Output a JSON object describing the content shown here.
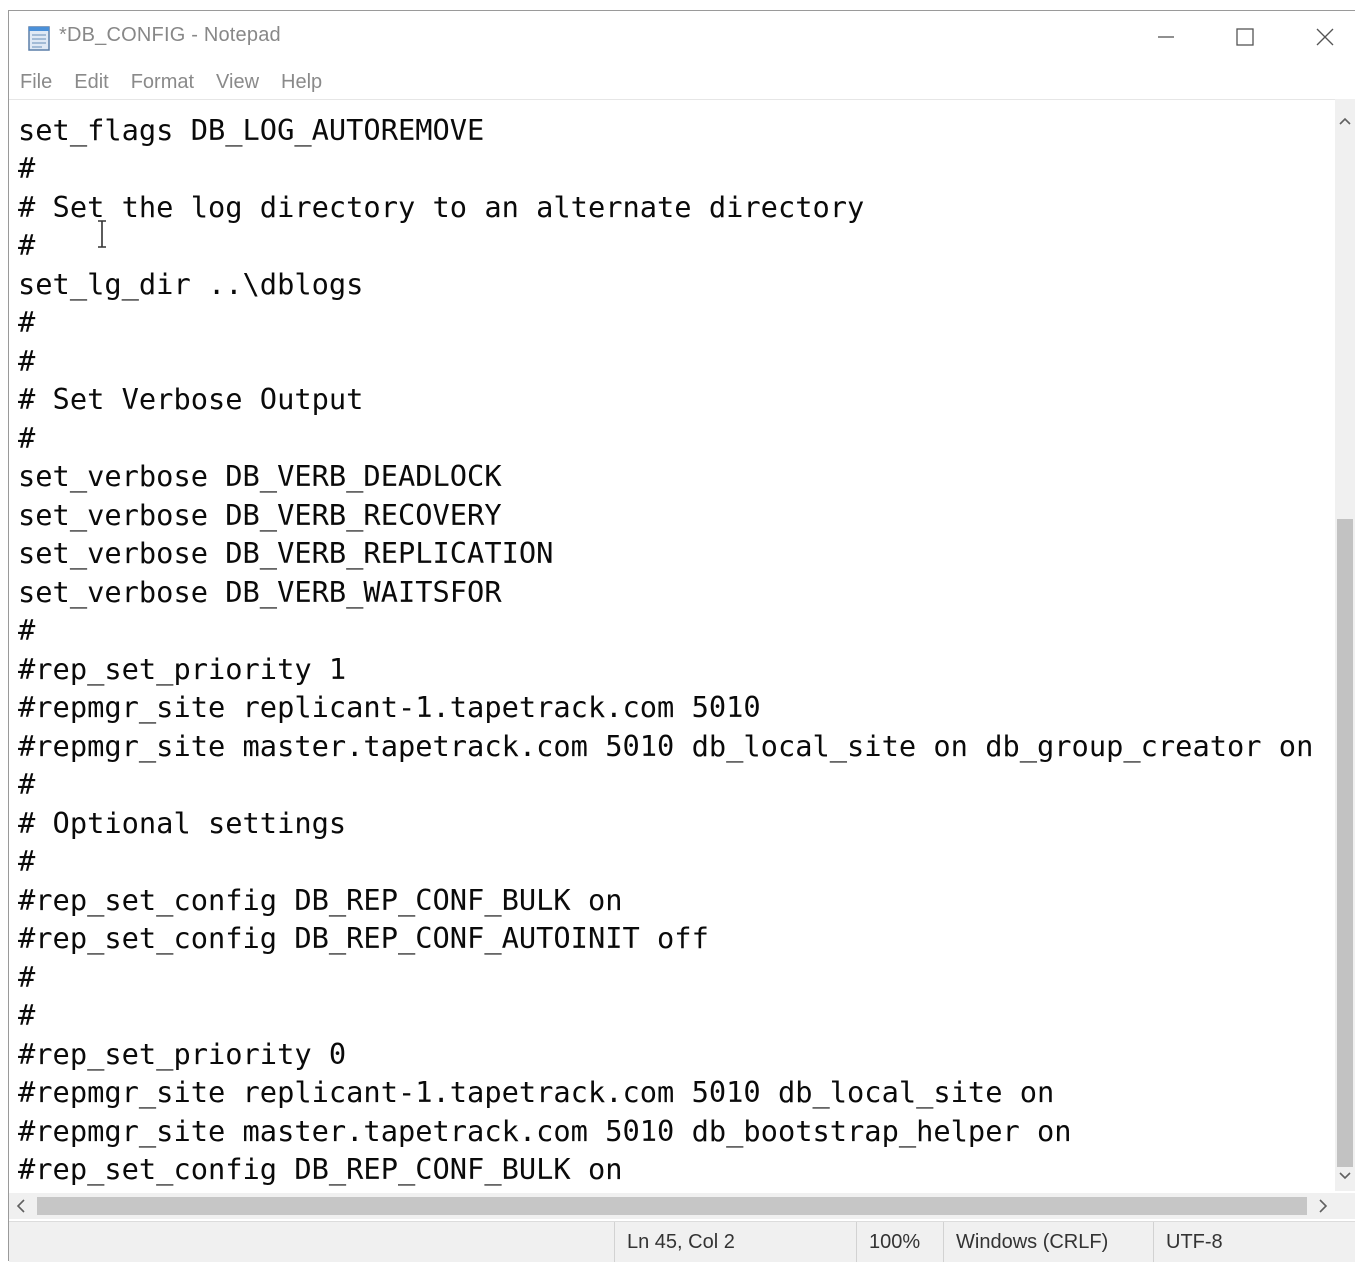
{
  "window": {
    "title": "*DB_CONFIG - Notepad",
    "icon": "notepad-icon",
    "controls": [
      "minimize-icon",
      "maximize-icon",
      "close-icon"
    ]
  },
  "menu": {
    "items": [
      "File",
      "Edit",
      "Format",
      "View",
      "Help"
    ]
  },
  "editor": {
    "lines": [
      "set_flags DB_LOG_AUTOREMOVE",
      "#",
      "# Set the log directory to an alternate directory",
      "#",
      "set_lg_dir ..\\dblogs",
      "#",
      "#",
      "# Set Verbose Output",
      "#",
      "set_verbose DB_VERB_DEADLOCK",
      "set_verbose DB_VERB_RECOVERY",
      "set_verbose DB_VERB_REPLICATION",
      "set_verbose DB_VERB_WAITSFOR",
      "#",
      "#rep_set_priority 1",
      "#repmgr_site replicant-1.tapetrack.com 5010",
      "#repmgr_site master.tapetrack.com 5010 db_local_site on db_group_creator on",
      "#",
      "# Optional settings",
      "#",
      "#rep_set_config DB_REP_CONF_BULK on",
      "#rep_set_config DB_REP_CONF_AUTOINIT off",
      "#",
      "#",
      "#rep_set_priority 0",
      "#repmgr_site replicant-1.tapetrack.com 5010 db_local_site on",
      "#repmgr_site master.tapetrack.com 5010 db_bootstrap_helper on",
      "#rep_set_config DB_REP_CONF_BULK on"
    ]
  },
  "statusbar": {
    "position": "Ln 45, Col 2",
    "zoom": "100%",
    "line_ending": "Windows (CRLF)",
    "encoding": "UTF-8"
  }
}
